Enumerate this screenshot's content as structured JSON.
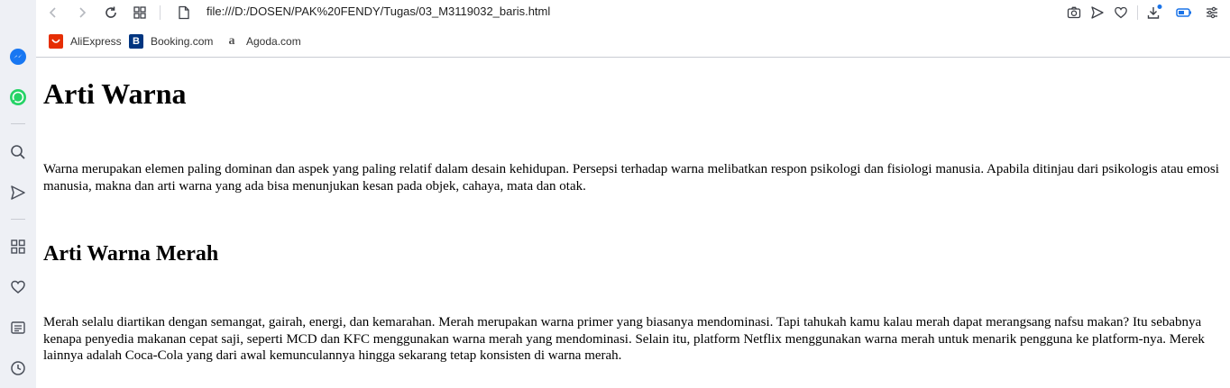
{
  "browser": {
    "url": "file:///D:/DOSEN/PAK%20FENDY/Tugas/03_M3119032_baris.html"
  },
  "bookmarks": [
    {
      "label": "AliExpress",
      "icon": "aliexpress-icon",
      "color": "#e62e04"
    },
    {
      "label": "Booking.com",
      "icon": "booking-icon",
      "color": "#003580"
    },
    {
      "label": "Agoda.com",
      "icon": "agoda-icon",
      "color": "#555555"
    }
  ],
  "page": {
    "h1": "Arti Warna",
    "p1": "Warna merupakan elemen paling dominan dan aspek yang paling relatif dalam desain kehidupan. Persepsi terhadap warna melibatkan respon psikologi dan fisiologi manusia. Apabila ditinjau dari psikologis atau emosi manusia, makna dan arti warna yang ada bisa menunjukan kesan pada objek, cahaya, mata dan otak.",
    "h2": "Arti Warna Merah",
    "p2": "Merah selalu diartikan dengan semangat, gairah, energi, dan kemarahan. Merah merupakan warna primer yang biasanya mendominasi. Tapi tahukah kamu kalau merah dapat merangsang nafsu makan? Itu sebabnya kenapa penyedia makanan cepat saji, seperti MCD dan KFC menggunakan warna merah yang mendominasi. Selain itu, platform Netflix menggunakan warna merah untuk menarik pengguna ke platform-nya. Merek lainnya adalah Coca-Cola yang dari awal kemunculannya hingga sekarang tetap konsisten di warna merah."
  }
}
